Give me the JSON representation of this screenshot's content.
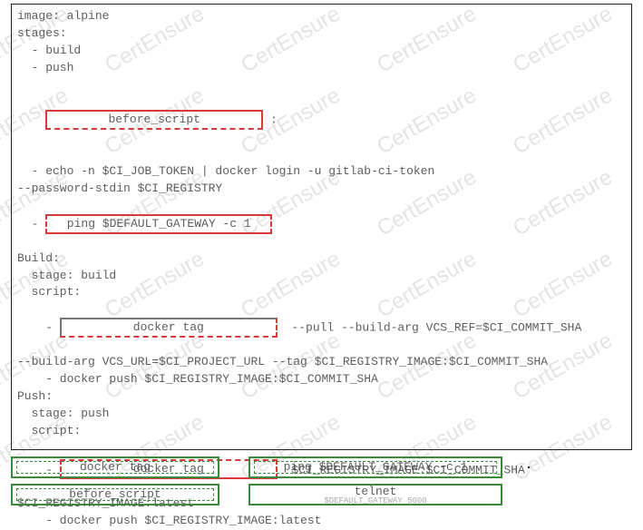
{
  "watermark_text": "CertEnsure",
  "code": {
    "l1": "image: alpine",
    "l2": "stages:",
    "l3": "  - build",
    "l4": "  - push",
    "drop1": "before_script",
    "drop1_suffix": " :",
    "l6": "  - echo -n $CI_JOB_TOKEN | docker login -u gitlab-ci-token",
    "l7": "--password-stdin $CI_REGISTRY",
    "drop2_prefix": "  - ",
    "drop2": "ping $DEFAULT_GATEWAY -c 1",
    "l9": "Build:",
    "l10": "  stage: build",
    "l11": "  script:",
    "drop3_prefix": "    - ",
    "drop3": "docker tag",
    "drop3_suffix": "  --pull --build-arg VCS_REF=$CI_COMMIT_SHA",
    "l13": "--build-arg VCS_URL=$CI_PROJECT_URL --tag $CI_REGISTRY_IMAGE:$CI_COMMIT_SHA",
    "l14": "    - docker push $CI_REGISTRY_IMAGE:$CI_COMMIT_SHA",
    "l15": "Push:",
    "l16": "  stage: push",
    "l17": "  script:",
    "drop4_prefix": "    - ",
    "drop4": "docker tag",
    "drop4_suffix": "  $CI_REGISTRY_IMAGE:$CI_COMMIT_SHA",
    "l19": "$CI_REGISTRY_IMAGE:latest",
    "l20": "    - docker push $CI_REGISTRY_IMAGE:latest"
  },
  "options": {
    "o1": "docker tag",
    "o2": "ping $DEFAULT_GATEWAY -c 1",
    "o3": "before_script",
    "o4": "telnet",
    "o4b": "$DEFAULT_GATEWAY 5000"
  }
}
